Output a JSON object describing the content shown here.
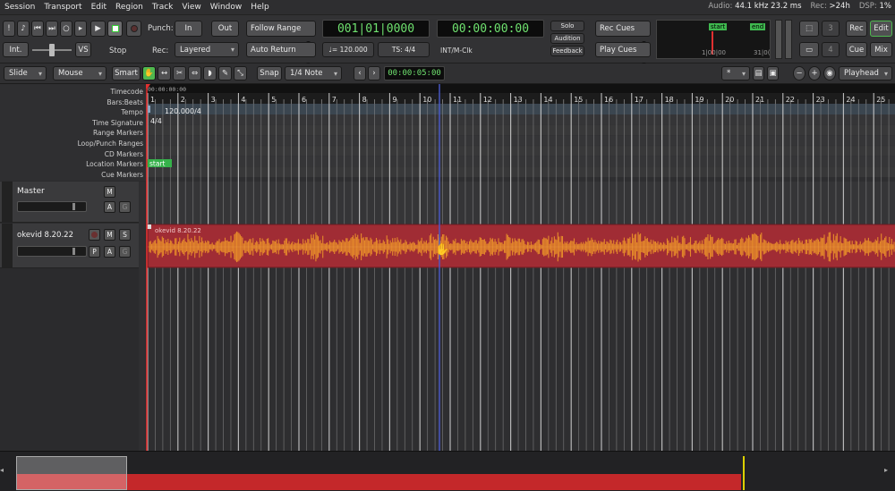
{
  "menu": [
    "Session",
    "Transport",
    "Edit",
    "Region",
    "Track",
    "View",
    "Window",
    "Help"
  ],
  "status": {
    "audio_label": "Audio:",
    "audio_value": "44.1 kHz 23.2 ms",
    "rec_label": "Rec:",
    "rec_value": ">24h",
    "dsp_label": "DSP:",
    "dsp_value": "1%"
  },
  "transport": {
    "punch_label": "Punch:",
    "in_label": "In",
    "out_label": "Out",
    "rec_label": "Rec:",
    "rec_mode": "Layered",
    "int_label": "Int.",
    "vs_label": "VS",
    "stop_label": "Stop",
    "follow_range": "Follow Range",
    "auto_return": "Auto Return",
    "bbt_clock": "001|01|0000",
    "timecode_clock": "00:00:00:00",
    "tempo_value": "♩= 120.000",
    "ts_value": "TS: 4/4",
    "sync_label": "INT/M-Clk",
    "solo": "Solo",
    "audition": "Audition",
    "feedback": "Feedback",
    "rec_cues": "Rec Cues",
    "play_cues": "Play Cues",
    "mini_start": "start",
    "mini_end": "end",
    "mini_left": "1|00|00",
    "mini_right": "31|0(",
    "n3": "3",
    "n4": "4",
    "rec_btn": "Rec",
    "edit_btn": "Edit",
    "cue_btn": "Cue",
    "mix_btn": "Mix"
  },
  "edit_toolbar": {
    "edit_mode": "Slide",
    "tool_mode": "Mouse",
    "smart": "Smart",
    "snap": "Snap",
    "grid": "1/4 Note",
    "nudge_clock": "00:00:05:00",
    "zoom_sel": "*",
    "zoom_focus": "Playhead"
  },
  "ruler_labels": [
    "Timecode",
    "Bars:Beats",
    "Tempo",
    "Time Signature",
    "Range Markers",
    "Loop/Punch Ranges",
    "CD Markers",
    "Location Markers",
    "Cue Markers"
  ],
  "ruler_values": {
    "timecode_start": "00:00:00:00",
    "tempo": "120.000/4",
    "meter": "4/4",
    "start_marker": "start"
  },
  "bars": [
    "1",
    "2",
    "3",
    "4",
    "5",
    "6",
    "7",
    "8",
    "9",
    "10",
    "11",
    "12",
    "13",
    "14",
    "15",
    "16",
    "17",
    "18",
    "19",
    "20",
    "21",
    "22",
    "23",
    "24",
    "25"
  ],
  "tracks": [
    {
      "name": "Master",
      "buttons": [
        "M",
        "A",
        "G"
      ]
    },
    {
      "name": "okevid 8.20.22",
      "buttons": [
        "M",
        "S",
        "P",
        "A",
        "G"
      ],
      "region_name": "okevid 8.20.22"
    }
  ],
  "colors": {
    "region_bg": "#a02c34",
    "waveform": "#e58a2a",
    "playhead": "#e03030",
    "cursor": "#4a5acc",
    "lcd_text": "#6fe26f",
    "edit_active": "#4fb84f"
  }
}
